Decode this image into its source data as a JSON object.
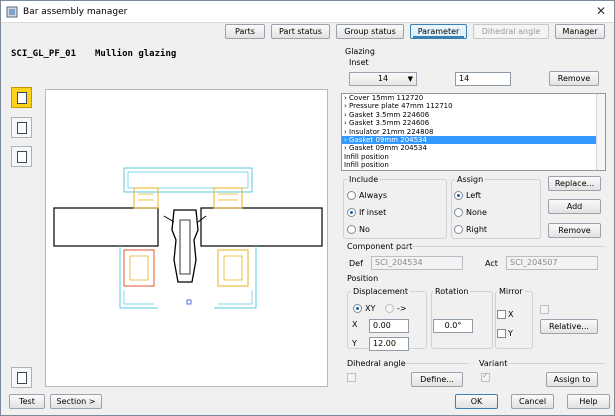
{
  "window": {
    "title": "Bar assembly manager",
    "close": "✕"
  },
  "tabs": [
    {
      "label": "Parts",
      "state": "normal"
    },
    {
      "label": "Part status",
      "state": "normal"
    },
    {
      "label": "Group status",
      "state": "normal"
    },
    {
      "label": "Parameter",
      "state": "selected"
    },
    {
      "label": "Dihedral angle",
      "state": "disabled"
    },
    {
      "label": "Manager",
      "state": "normal"
    }
  ],
  "header": {
    "code": "SCI_GL_PF_01",
    "name": "Mullion glazing"
  },
  "glazing": {
    "section_label": "Glazing",
    "inset_label": "Inset",
    "inset_select": "14",
    "inset_value": "14",
    "remove_label": "Remove",
    "items": [
      "› Cover 15mm      112720",
      "› Pressure plate 47mm    112710",
      "› Gasket 3.5mm     224606",
      "› Gasket 3.5mm     224606",
      "› Insulator 21mm    224808",
      "› Gasket 09mm     204534",
      "› Gasket 09mm     204534",
      "Infill position",
      "Infill position"
    ],
    "selected_index": 5
  },
  "include": {
    "label": "Include",
    "options": [
      "Always",
      "If inset",
      "No"
    ],
    "selected": 1
  },
  "assign": {
    "label": "Assign",
    "options": [
      "Left",
      "None",
      "Right"
    ],
    "selected": 0
  },
  "actions": {
    "replace": "Replace...",
    "add": "Add",
    "remove": "Remove"
  },
  "component": {
    "label": "Component part",
    "def_label": "Def",
    "def_value": "SCI_204534",
    "act_label": "Act",
    "act_value": "SCI_204507"
  },
  "position": {
    "label": "Position",
    "displacement_label": "Displacement",
    "xy_label": "XY",
    "arrow_label": "->",
    "x_label": "X",
    "x_value": "0.00",
    "y_label": "Y",
    "y_value": "12.00",
    "rotation_label": "Rotation",
    "rotation_value": "0.0°",
    "mirror_label": "Mirror",
    "mirror_x": "X",
    "mirror_y": "Y",
    "relative_label": "Relative..."
  },
  "dihedral": {
    "label": "Dihedral angle",
    "define_label": "Define..."
  },
  "variant": {
    "label": "Variant",
    "assign_label": "Assign to"
  },
  "footer": {
    "test": "Test",
    "section": "Section >",
    "ok": "OK",
    "cancel": "Cancel",
    "help": "Help"
  },
  "colors": {
    "accent": "#3c7fb1",
    "selection": "#3399ff",
    "active_tool": "#ffd21a"
  },
  "icons": {
    "title": "app-icon",
    "tools": [
      "glazing-tool-icon",
      "profile-tool-icon",
      "sheet-tool-icon",
      "bottom-tool-icon"
    ]
  }
}
